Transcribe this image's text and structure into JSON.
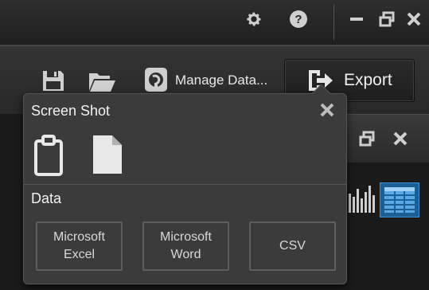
{
  "titlebar": {
    "icons": [
      "gear-icon",
      "help-icon",
      "minimize-icon",
      "restore-icon",
      "close-icon"
    ]
  },
  "toolbar": {
    "save_icon": "save-icon",
    "open_icon": "folder-open-icon",
    "manage_data_label": "Manage Data...",
    "export_label": "Export"
  },
  "export_popup": {
    "screenshot_title": "Screen Shot",
    "screenshot_options": [
      "clipboard-icon",
      "document-icon"
    ],
    "data_title": "Data",
    "options": {
      "excel_line1": "Microsoft",
      "excel_line2": "Excel",
      "word_line1": "Microsoft",
      "word_line2": "Word",
      "csv": "CSV"
    }
  },
  "colors": {
    "accent_blue": "#3a8fd6",
    "popup_bg": "#3b3b3b",
    "titlebar_bg": "#262626"
  }
}
